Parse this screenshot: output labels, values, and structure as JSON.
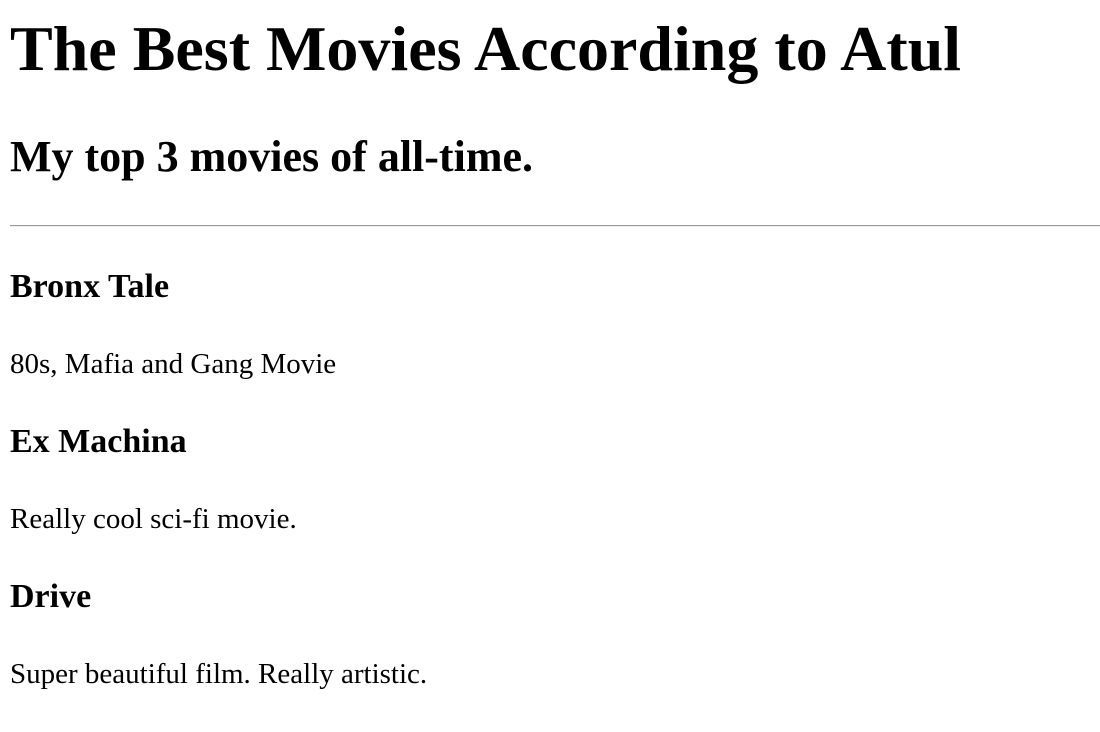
{
  "page": {
    "title": "The Best Movies According to Atul",
    "subtitle": "My top 3 movies of all-time."
  },
  "movies": [
    {
      "title": "Bronx Tale",
      "description": "80s, Mafia and Gang Movie"
    },
    {
      "title": "Ex Machina",
      "description": "Really cool sci-fi movie."
    },
    {
      "title": "Drive",
      "description": "Super beautiful film. Really artistic."
    }
  ]
}
